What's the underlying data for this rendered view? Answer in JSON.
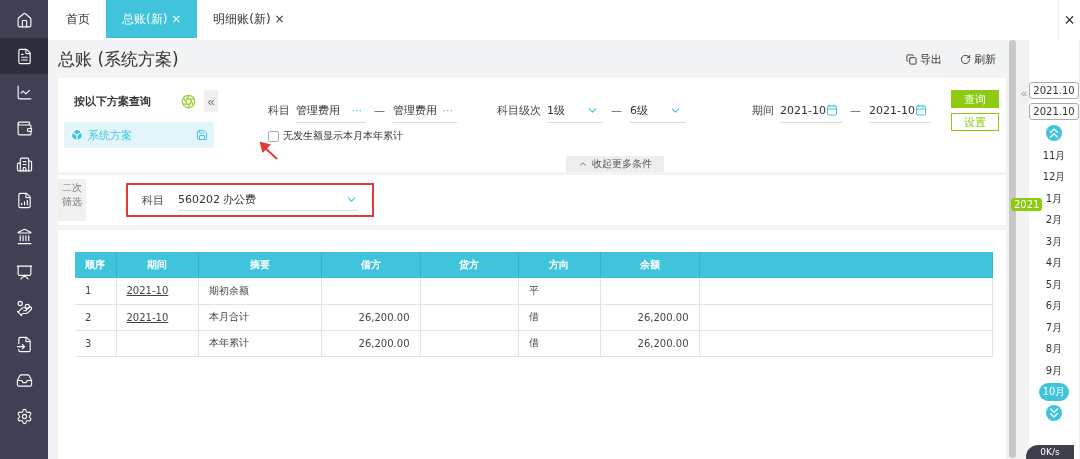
{
  "sidebar": {
    "items": [
      {
        "selected": false
      },
      {
        "selected": true
      },
      {
        "selected": false
      },
      {
        "selected": false
      },
      {
        "selected": false
      },
      {
        "selected": false
      },
      {
        "selected": false
      },
      {
        "selected": false
      },
      {
        "selected": false
      },
      {
        "selected": false
      },
      {
        "selected": false
      },
      {
        "selected": false
      }
    ]
  },
  "tabs": [
    {
      "label": "首页",
      "selected": false
    },
    {
      "label": "总账(新)",
      "selected": true,
      "close": "×"
    },
    {
      "label": "明细账(新)",
      "selected": false,
      "close": "×"
    }
  ],
  "window_close": "×",
  "page_title": "总账 (系统方案)",
  "toolbar": [
    {
      "label": "导出"
    },
    {
      "label": "刷新"
    }
  ],
  "scheme_panel": {
    "title": "按以下方案查询",
    "collapse": "«",
    "scheme": "系统方案"
  },
  "filters": {
    "subject": {
      "label": "科目",
      "from": "管理费用",
      "to": "管理费用",
      "more": "···",
      "dash": "—"
    },
    "level": {
      "label": "科目级次",
      "from": "1级",
      "to": "6级",
      "dash": "—"
    },
    "period": {
      "label": "期间",
      "from": "2021-10",
      "to": "2021-10",
      "dash": "—"
    }
  },
  "buttons": {
    "query": "查询",
    "settings": "设置"
  },
  "checkbox": {
    "label": "无发生额显示本月本年累计",
    "checked": false
  },
  "collapse_toggle": "收起更多条件",
  "secondary_filter": {
    "title": "二次筛选",
    "label": "科目",
    "value": "560202 办公费",
    "highlighted": true
  },
  "table": {
    "columns": [
      "顺序",
      "期间",
      "摘要",
      "借方",
      "贷方",
      "方向",
      "余额"
    ],
    "rows": [
      [
        "1",
        "2021-10",
        "期初余额",
        "",
        "",
        "平",
        ""
      ],
      [
        "2",
        "2021-10",
        "本月合计",
        "26,200.00",
        "",
        "借",
        "26,200.00"
      ],
      [
        "3",
        "",
        "本年累计",
        "26,200.00",
        "",
        "借",
        "26,200.00"
      ]
    ]
  },
  "month_panel": {
    "collapse": "«",
    "from": "2021.10",
    "to": "2021.10",
    "year_badge": "2021",
    "months": [
      {
        "label": "11月",
        "selected": false
      },
      {
        "label": "12月",
        "selected": false
      },
      {
        "label": "1月",
        "selected": false
      },
      {
        "label": "2月",
        "selected": false
      },
      {
        "label": "3月",
        "selected": false
      },
      {
        "label": "4月",
        "selected": false
      },
      {
        "label": "5月",
        "selected": false
      },
      {
        "label": "6月",
        "selected": false
      },
      {
        "label": "7月",
        "selected": false
      },
      {
        "label": "8月",
        "selected": false
      },
      {
        "label": "9月",
        "selected": false
      },
      {
        "label": "10月",
        "selected": true
      }
    ]
  },
  "speed_widget": {
    "text": "0K/s"
  }
}
